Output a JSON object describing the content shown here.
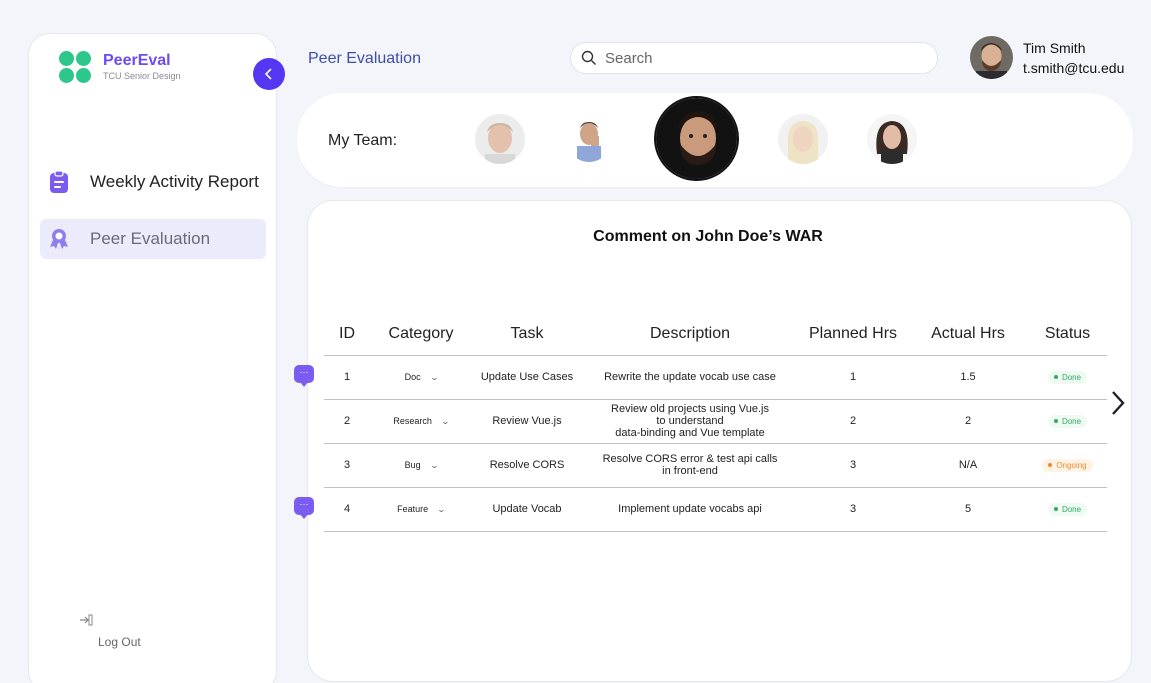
{
  "brand": {
    "name": "PeerEval",
    "subtitle": "TCU Senior Design"
  },
  "sidebar": {
    "items": [
      {
        "label": "Weekly Activity Report",
        "icon": "clipboard-icon",
        "active": false
      },
      {
        "label": "Peer Evaluation",
        "icon": "award-icon",
        "active": true
      }
    ],
    "logout_label": "Log Out"
  },
  "header": {
    "title": "Peer Evaluation",
    "search_placeholder": "Search",
    "user_name": "Tim Smith",
    "user_email": "t.smith@tcu.edu"
  },
  "team": {
    "label": "My Team:",
    "selected_index": 2
  },
  "war": {
    "title": "Comment on John Doe’s WAR",
    "columns": [
      "ID",
      "Category",
      "Task",
      "Description",
      "Planned Hrs",
      "Actual Hrs",
      "Status"
    ],
    "rows": [
      {
        "id": "1",
        "category": "Doc",
        "task": "Update Use Cases",
        "description": [
          "Rewrite the update vocab use case"
        ],
        "planned": "1",
        "actual": "1.5",
        "status": "Done",
        "has_comment": true
      },
      {
        "id": "2",
        "category": "Research",
        "task": "Review Vue.js",
        "description": [
          "Review old projects using Vue.js",
          "to understand",
          "data-binding and Vue template"
        ],
        "planned": "2",
        "actual": "2",
        "status": "Done",
        "has_comment": false
      },
      {
        "id": "3",
        "category": "Bug",
        "task": "Resolve CORS",
        "description": [
          "Resolve CORS error & test api calls",
          "in front-end"
        ],
        "planned": "3",
        "actual": "N/A",
        "status": "Ongoing",
        "has_comment": false
      },
      {
        "id": "4",
        "category": "Feature",
        "task": "Update Vocab",
        "description": [
          "Implement update vocabs api"
        ],
        "planned": "3",
        "actual": "5",
        "status": "Done",
        "has_comment": true
      }
    ]
  },
  "colors": {
    "accent": "#5436f3",
    "brand_green": "#2dc78c",
    "done": "#2fae63",
    "ongoing": "#f08b2c"
  }
}
